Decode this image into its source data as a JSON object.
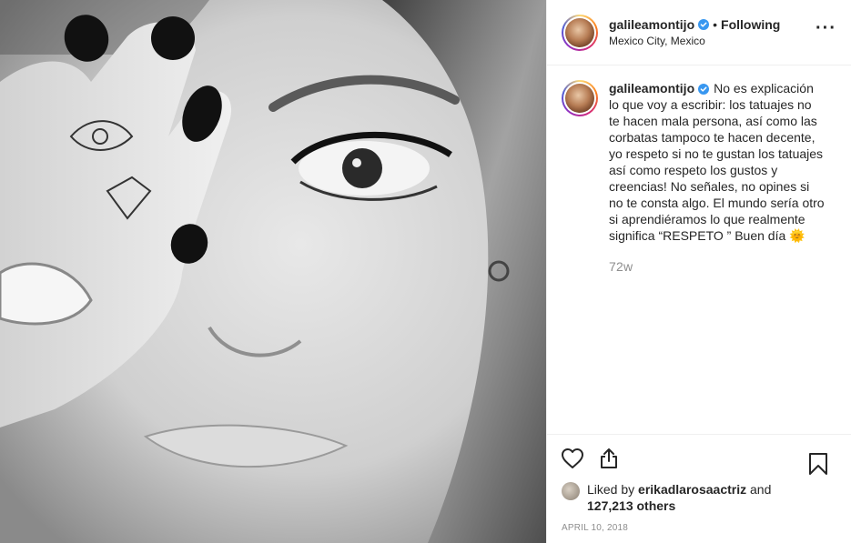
{
  "post": {
    "photo_alt": "",
    "author": {
      "username": "galileamontijo",
      "location": "Mexico City, Mexico",
      "verified": true,
      "follow_separator": "•",
      "follow_status": "Following"
    },
    "more_icon": "more-options-icon",
    "caption": {
      "username": "galileamontijo",
      "text": "No es explicación lo que voy a escribir: los tatuajes no te hacen mala persona, así como las corbatas tampoco te hacen decente, yo respeto si no te gustan los tatuajes así como respeto los gustos y creencias! No señales, no opines si no te consta algo. El mundo sería otro si aprendiéramos lo que realmente significa “RESPETO ” Buen día 🌞",
      "age": "72w"
    },
    "actions": {
      "like_icon": "heart-icon",
      "share_icon": "share-icon",
      "save_icon": "bookmark-icon"
    },
    "likes": {
      "prefix": "Liked by",
      "liker": "erikadlarosaactriz",
      "and": "and",
      "others": "127,213 others"
    },
    "date": "April 10, 2018"
  },
  "colors": {
    "text": "#262626",
    "muted": "#8e8e8e",
    "verified": "#3897f0",
    "border": "#efefef"
  }
}
